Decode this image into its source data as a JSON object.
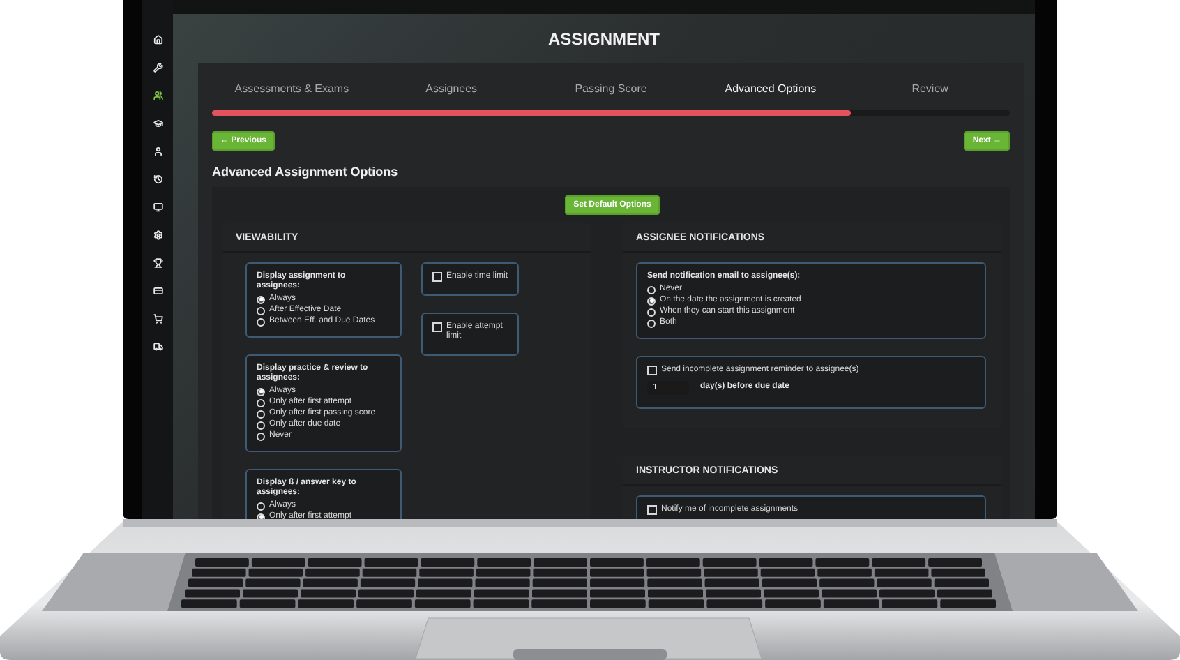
{
  "app": {
    "title": "ASSIGNMENT"
  },
  "sidebar": {
    "items": [
      {
        "selected": false
      },
      {
        "selected": false
      },
      {
        "selected": true
      },
      {
        "selected": false
      },
      {
        "selected": false
      },
      {
        "selected": false
      },
      {
        "selected": false
      },
      {
        "selected": false
      },
      {
        "selected": false
      },
      {
        "selected": false
      },
      {
        "selected": false
      },
      {
        "selected": false
      }
    ]
  },
  "steps": [
    {
      "label": "Assessments & Exams",
      "selected": false
    },
    {
      "label": "Assignees",
      "selected": false
    },
    {
      "label": "Passing Score",
      "selected": false
    },
    {
      "label": "Advanced Options",
      "selected": true
    },
    {
      "label": "Review",
      "selected": false
    }
  ],
  "progress": {
    "level": 0.8
  },
  "nav": {
    "previous": "← Previous",
    "next": "Next →"
  },
  "section_title": "Advanced Assignment Options",
  "default_button": "Set Default Options",
  "viewability": {
    "title": "VIEWABILITY",
    "groups": [
      {
        "label": "Display assignment to assignees:",
        "options": [
          {
            "label": "Always",
            "selected": true
          },
          {
            "label": "After Effective Date",
            "selected": false
          },
          {
            "label": "Between Eff. and Due Dates",
            "selected": false
          }
        ]
      },
      {
        "label": "Display practice & review to assignees:",
        "options": [
          {
            "label": "Always",
            "selected": true
          },
          {
            "label": "Only after first attempt",
            "selected": false
          },
          {
            "label": "Only after first passing score",
            "selected": false
          },
          {
            "label": "Only after due date",
            "selected": false
          },
          {
            "label": "Never",
            "selected": false
          }
        ]
      },
      {
        "label": "Display ß / answer key to assignees:",
        "options": [
          {
            "label": "Always",
            "selected": false
          },
          {
            "label": "Only after first attempt",
            "selected": true
          }
        ]
      }
    ],
    "toggles": [
      {
        "label": "Enable time limit",
        "checked": false
      },
      {
        "label": "Enable attempt limit",
        "checked": false
      }
    ]
  },
  "assignee_notifications": {
    "title": "ASSIGNEE NOTIFICATIONS",
    "email": {
      "label": "Send notification email to assignee(s):",
      "options": [
        {
          "label": "Never",
          "selected": false
        },
        {
          "label": "On the date the assignment is created",
          "selected": true
        },
        {
          "label": "When they can start this assignment",
          "selected": false
        },
        {
          "label": "Both",
          "selected": false
        }
      ]
    },
    "reminder": {
      "label": "Send incomplete assignment reminder to assignee(s)",
      "checked": false,
      "days": "1",
      "suffix": "day(s) before due date"
    }
  },
  "instructor_notifications": {
    "title": "INSTRUCTOR NOTIFICATIONS",
    "items": [
      {
        "label": "Notify me of incomplete assignments",
        "checked": false
      }
    ]
  }
}
